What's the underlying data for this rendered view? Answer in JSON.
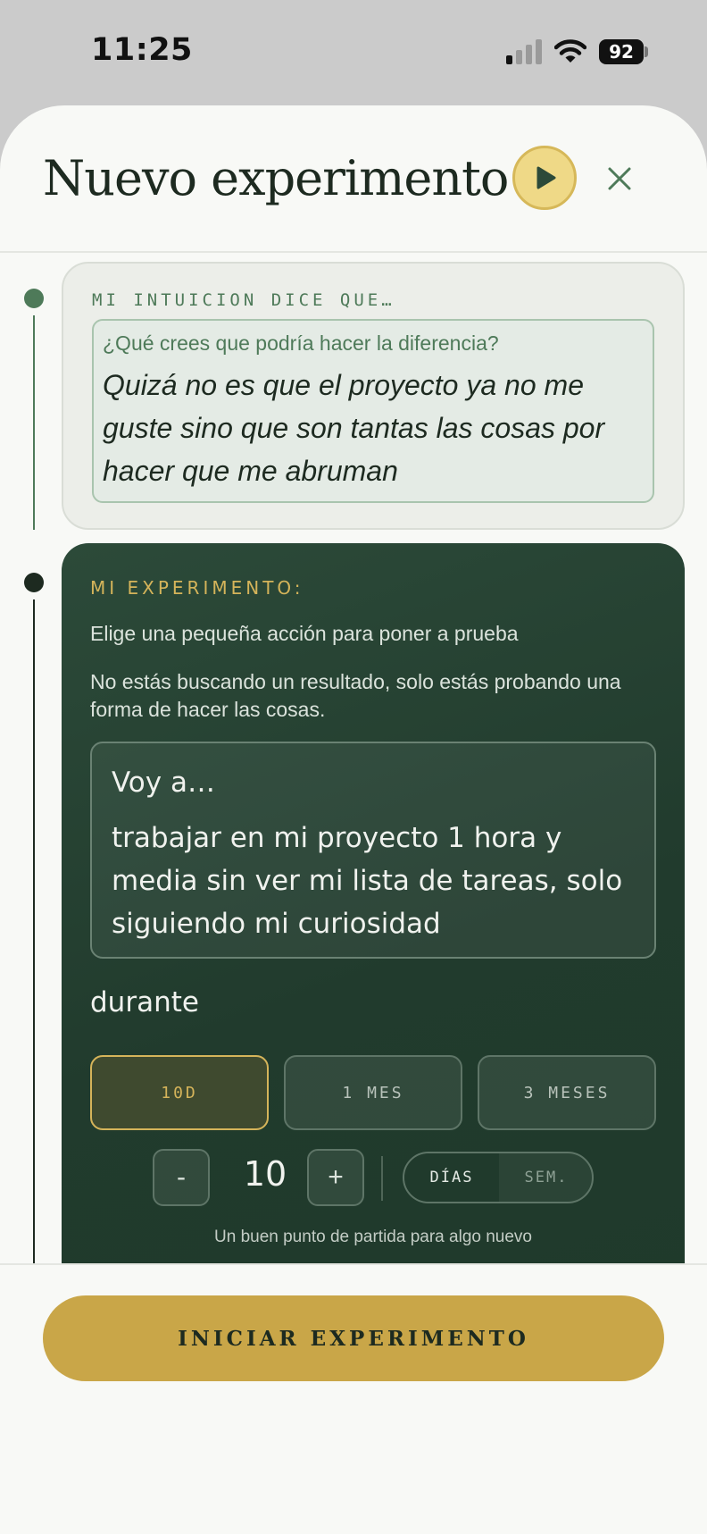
{
  "status_bar": {
    "time": "11:25",
    "battery": "92"
  },
  "header": {
    "title": "Nuevo experimento"
  },
  "intuition": {
    "eyebrow": "MI INTUICION DICE QUE…",
    "question": "¿Qué crees que podría hacer la diferencia?",
    "answer": "Quizá no es que el proyecto ya no me guste sino que son tantas las cosas por hacer que me abruman"
  },
  "experiment": {
    "eyebrow": "MI EXPERIMENTO:",
    "description": "Elige una pequeña acción para poner a prueba",
    "note": "No estás buscando un resultado, solo estás probando una forma de hacer las cosas.",
    "action_prefix": "Voy a…",
    "action_text": "trabajar en mi proyecto 1 hora y media sin ver mi lista de tareas, solo siguiendo mi curiosidad",
    "duration_label": "durante",
    "duration_options": [
      {
        "label": "10D",
        "selected": true
      },
      {
        "label": "1 MES",
        "selected": false
      },
      {
        "label": "3 MESES",
        "selected": false
      }
    ],
    "stepper": {
      "minus": "-",
      "value": "10",
      "plus": "+"
    },
    "units": [
      {
        "label": "DÍAS",
        "selected": true
      },
      {
        "label": "SEM.",
        "selected": false
      }
    ],
    "hint": "Un buen punto de partida para algo nuevo"
  },
  "footer": {
    "start_label": "INICIAR EXPERIMENTO"
  },
  "colors": {
    "accent_gold": "#c9a648",
    "dark_green": "#213b2d",
    "green": "#4e7a59"
  },
  "icons": {
    "play": "play-icon",
    "close": "close-icon",
    "signal": "signal-icon",
    "wifi": "wifi-icon",
    "battery": "battery-icon"
  }
}
